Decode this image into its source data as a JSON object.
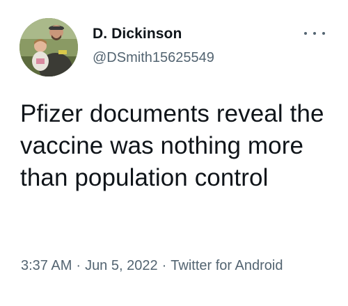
{
  "user": {
    "display_name": "D. Dickinson",
    "handle": "@DSmith15625549",
    "avatar_icon": "profile-photo",
    "more_icon": "more-horizontal-icon"
  },
  "tweet": {
    "text": "Pfizer documents reveal the vaccine was nothing more than population control"
  },
  "meta": {
    "time": "3:37 AM",
    "separator": "·",
    "date": "Jun 5, 2022",
    "source": "Twitter for Android"
  },
  "colors": {
    "text_primary": "#0f1419",
    "text_secondary": "#536471",
    "background": "#ffffff"
  }
}
